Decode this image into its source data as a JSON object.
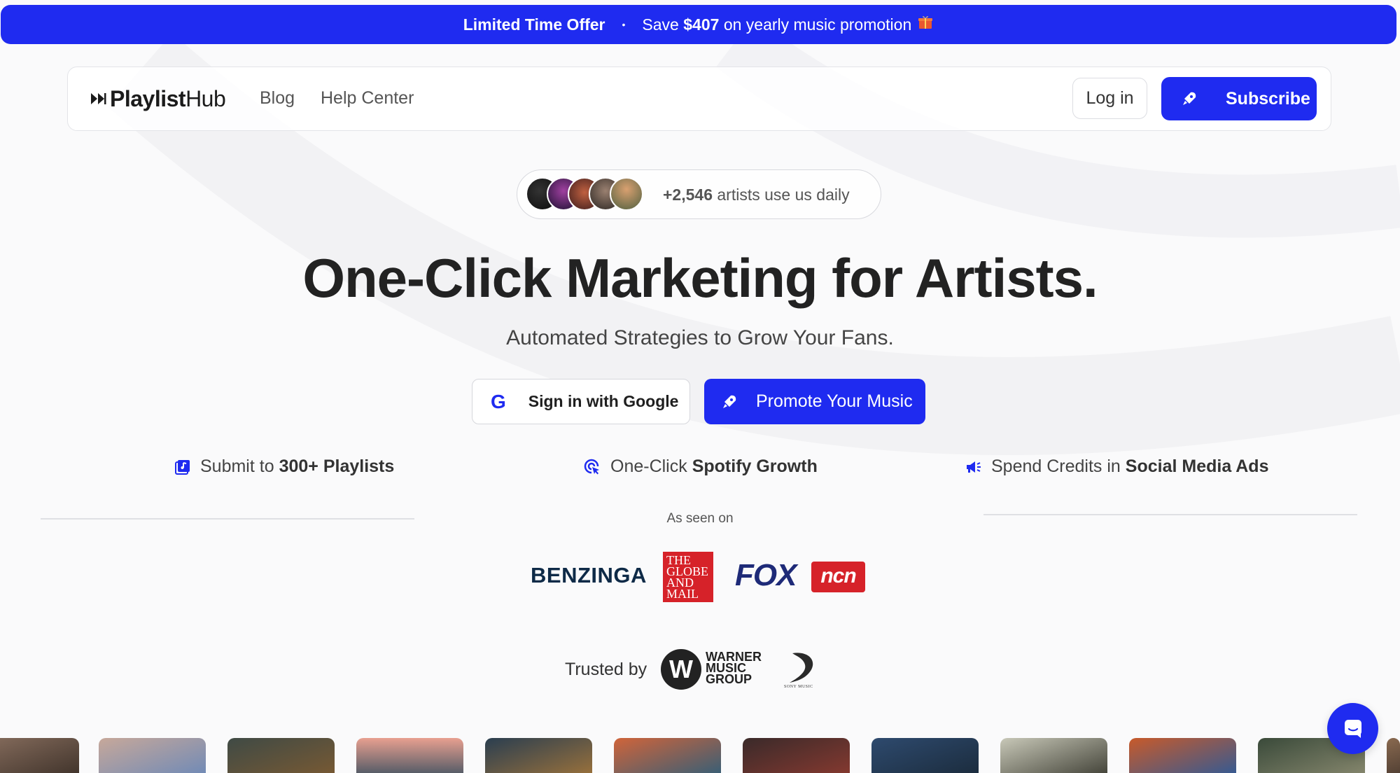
{
  "promo": {
    "headline": "Limited Time Offer",
    "bullet": "•",
    "text_before": "Save",
    "amount": "$407",
    "text_after": "on yearly music promotion",
    "gift_icon": "gift-icon"
  },
  "nav": {
    "logo_part1": "Playlist",
    "logo_part2": "Hub",
    "links": [
      "Blog",
      "Help Center"
    ],
    "login_label": "Log in",
    "subscribe_label": "Subscribe"
  },
  "social_proof": {
    "count": "+2,546",
    "text": "artists use us daily"
  },
  "hero": {
    "title": "One-Click Marketing for Artists.",
    "subtitle": "Automated Strategies to Grow Your Fans.",
    "google_g": "G",
    "google_label": "Sign in with Google",
    "promote_label": "Promote Your Music"
  },
  "features": [
    {
      "prefix": "Submit to",
      "bold": "300+ Playlists",
      "icon": "playlist-icon"
    },
    {
      "prefix": "One-Click",
      "bold": "Spotify Growth",
      "icon": "click-icon"
    },
    {
      "prefix": "Spend Credits in",
      "bold": "Social Media Ads",
      "icon": "megaphone-icon"
    }
  ],
  "press": {
    "label": "As seen on",
    "benzinga": "BENZINGA",
    "globe": [
      "THE",
      "GLOBE",
      "AND",
      "MAIL"
    ],
    "fox": "FOX",
    "ncn": "ncn"
  },
  "trusted": {
    "label": "Trusted by",
    "wmg_mark": "W",
    "wmg_lines": [
      "WARNER",
      "MUSIC",
      "GROUP"
    ],
    "sony_text": "SONY MUSIC"
  },
  "colors": {
    "brand": "#1f2bf0",
    "text_dark": "#222222"
  }
}
